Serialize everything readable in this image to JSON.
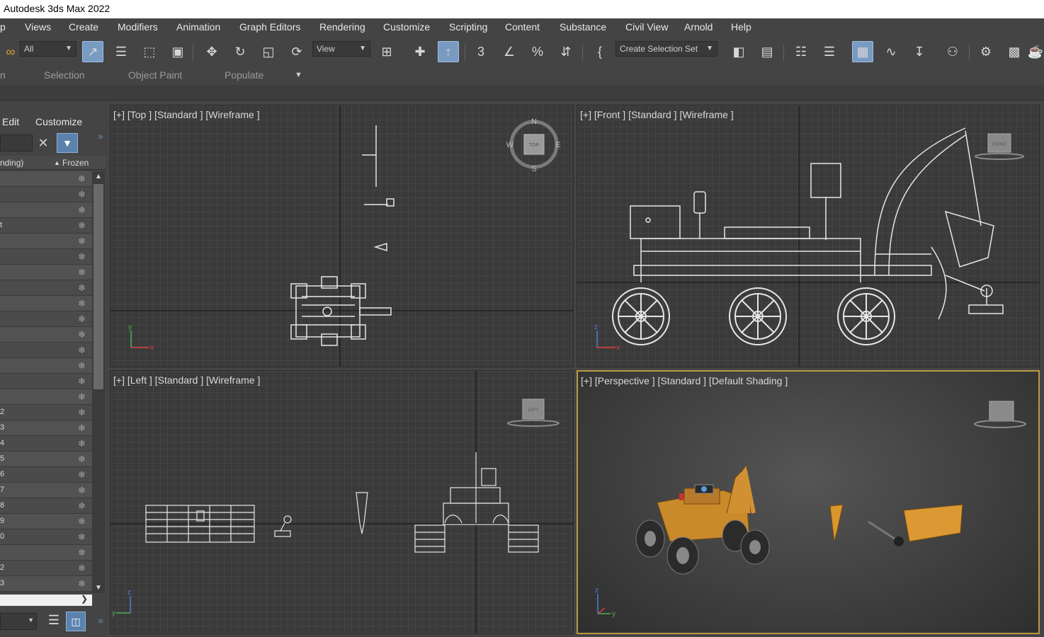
{
  "app": {
    "title": "Autodesk 3ds Max 2022"
  },
  "menu": [
    "p",
    "Views",
    "Create",
    "Modifiers",
    "Animation",
    "Graph Editors",
    "Rendering",
    "Customize",
    "Scripting",
    "Content",
    "Substance",
    "Civil View",
    "Arnold",
    "Help"
  ],
  "toolbar": {
    "filter_value": "All",
    "ref_coord_value": "View",
    "selection_set_value": "Create Selection Set"
  },
  "ribbon": {
    "items": [
      "n",
      "Selection",
      "Object Paint",
      "Populate"
    ]
  },
  "explorer": {
    "menu": [
      "Edit",
      "Customize"
    ],
    "col_name": "nding)",
    "col_frozen": "Frozen",
    "row_labels": [
      "",
      "",
      "",
      "t",
      "",
      "",
      "",
      "",
      "",
      "",
      "",
      "",
      "",
      "",
      "",
      "2",
      "3",
      "4",
      "5",
      "6",
      "7",
      "8",
      "9",
      "0",
      "",
      "2",
      "3"
    ]
  },
  "viewports": {
    "top": "[+] [Top ] [Standard ] [Wireframe ]",
    "front": "[+] [Front ] [Standard ] [Wireframe ]",
    "left": "[+] [Left ] [Standard ] [Wireframe ]",
    "perspective": "[+] [Perspective ] [Standard ] [Default Shading ]"
  },
  "viewcube": {
    "top": "TOP",
    "front": "FRONT",
    "left": "LEFT",
    "n": "N",
    "s": "S",
    "e": "E",
    "w": "W"
  },
  "axes": {
    "x": "x",
    "y": "y",
    "z": "z"
  }
}
